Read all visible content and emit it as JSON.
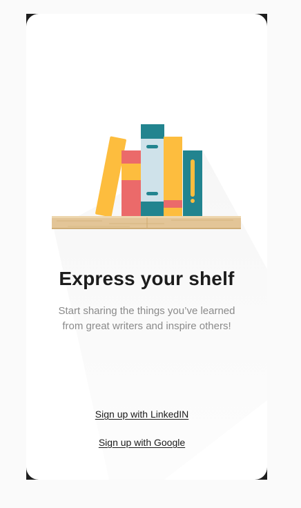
{
  "onboarding": {
    "title": "Express your shelf",
    "subtitle": "Start sharing the things you’ve learned from great writers and inspire others!",
    "linkedin_label": "Sign up with LinkedIN",
    "google_label": "Sign up with Google"
  },
  "colors": {
    "yellow": "#FDBD3E",
    "red": "#EB6A6A",
    "teal": "#22848F",
    "light_blue": "#CFE2EA",
    "shelf_wood": "#E3C597",
    "title_text": "#1C1C1C",
    "subtitle_text": "#8A8A8A"
  }
}
